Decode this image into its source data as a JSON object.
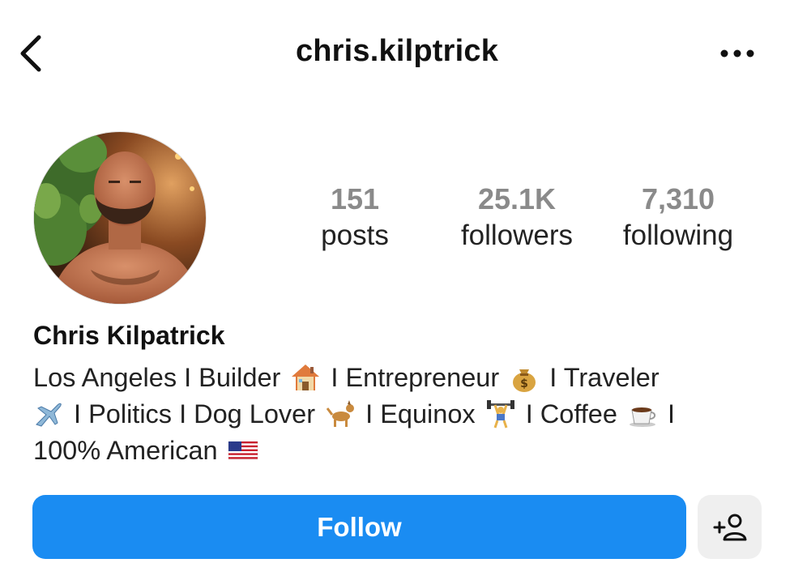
{
  "header": {
    "username": "chris.kilptrick",
    "back_icon": "chevron-left-icon",
    "more_icon": "more-horizontal-icon"
  },
  "profile": {
    "avatar": "profile-photo",
    "stats": [
      {
        "value": "151",
        "label": "posts"
      },
      {
        "value": "25.1K",
        "label": "followers"
      },
      {
        "value": "7,310",
        "label": "following"
      }
    ],
    "display_name": "Chris Kilpatrick",
    "bio": {
      "line1": [
        "Los Angeles I Builder",
        "I Entrepreneur",
        "I Traveler"
      ],
      "line2": [
        "I Politics I Dog Lover",
        "I Equinox",
        "I Coffee",
        "I"
      ],
      "line3": [
        "100% American"
      ]
    }
  },
  "actions": {
    "follow_label": "Follow",
    "suggest_icon": "add-person-icon"
  },
  "colors": {
    "follow_button": "#1a8cf2",
    "stat_number": "#8a8a8a",
    "secondary_button": "#efefef"
  }
}
